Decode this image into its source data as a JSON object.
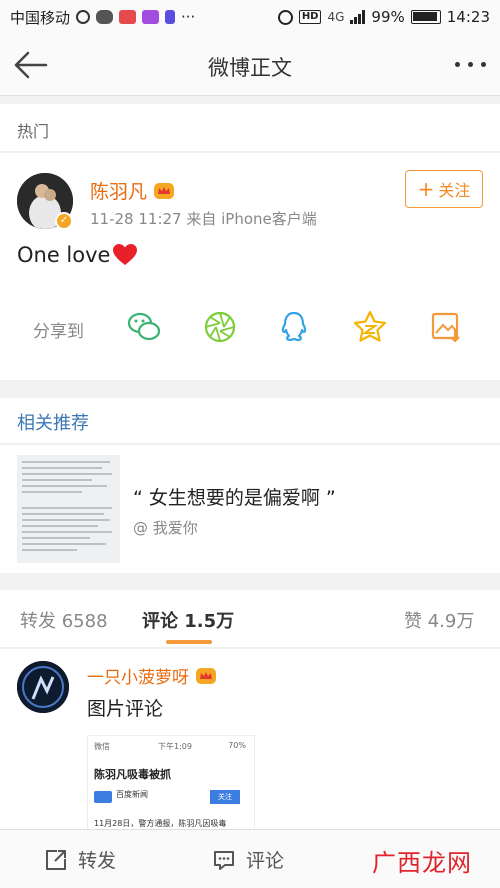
{
  "status_bar": {
    "carrier": "中国移动",
    "signal_mini": "4G",
    "battery": "99%",
    "time": "14:23",
    "dots": "···"
  },
  "header": {
    "title": "微博正文"
  },
  "hot_section": {
    "label": "热门"
  },
  "post": {
    "author": "陈羽凡",
    "meta": "11-28 11:27  来自 iPhone客户端",
    "follow_label": "关注",
    "content": "One love",
    "share_label": "分享到",
    "share_targets": [
      "wechat-icon",
      "moments-icon",
      "qq-icon",
      "qzone-icon",
      "save-image-icon"
    ]
  },
  "related": {
    "label": "相关推荐",
    "title": "“ 女生想要的是偏爱啊 ”",
    "subtitle": "@ 我爱你"
  },
  "tabs": {
    "repost": "转发 6588",
    "comments": "评论 1.5万",
    "likes": "赞 4.9万"
  },
  "comment": {
    "author": "一只小菠萝呀",
    "text": "图片评论",
    "image": {
      "status_left": "微信",
      "status_time": "下午1:09",
      "status_right": "70%",
      "headline": "陈羽凡吸毒被抓",
      "source": "百度新闻",
      "follow": "关注",
      "body": "11月28日，警方通报，陈羽凡因吸毒"
    }
  },
  "bottom_bar": {
    "repost": "转发",
    "comment": "评论",
    "watermark": "广西龙网"
  },
  "colors": {
    "accent_orange": "#f08a24",
    "link_blue": "#3d78b5",
    "heart_red": "#e8202a"
  }
}
